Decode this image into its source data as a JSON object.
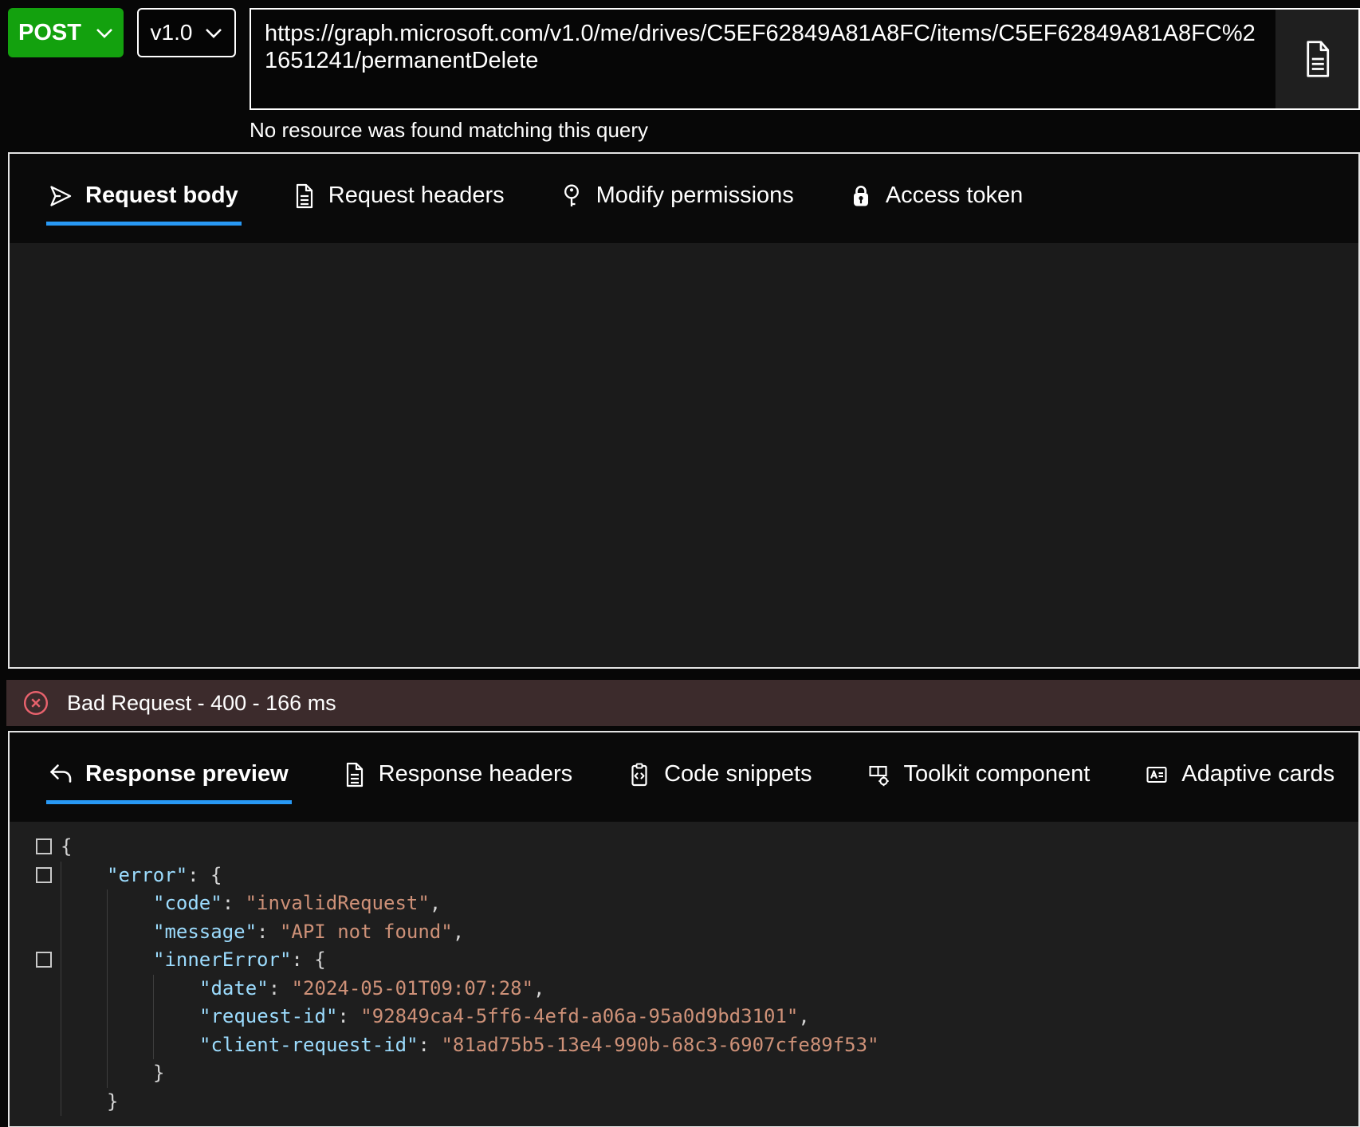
{
  "colors": {
    "accent": "#2899f5",
    "method_green": "#13a10e",
    "error_red": "#e8626d",
    "error_bar_bg": "#3c2b2c",
    "code_key": "#9cdcfe",
    "code_string": "#ce9178",
    "code_punct": "#d4d4d4"
  },
  "request_bar": {
    "method": "POST",
    "version": "v1.0",
    "url": "https://graph.microsoft.com/v1.0/me/drives/C5EF62849A81A8FC/items/C5EF62849A81A8FC%21651241/permanentDelete",
    "hint": "No resource was found matching this query"
  },
  "request_tabs": [
    {
      "label": "Request body",
      "icon": "send-icon",
      "active": true
    },
    {
      "label": "Request headers",
      "icon": "document-icon",
      "active": false
    },
    {
      "label": "Modify permissions",
      "icon": "key-icon",
      "active": false
    },
    {
      "label": "Access token",
      "icon": "lock-icon",
      "active": false
    }
  ],
  "status": {
    "text": "Bad Request - 400 - 166 ms",
    "icon": "error-circle-icon"
  },
  "response_tabs": [
    {
      "label": "Response preview",
      "icon": "reply-arrow-icon",
      "active": true
    },
    {
      "label": "Response headers",
      "icon": "document-icon",
      "active": false
    },
    {
      "label": "Code snippets",
      "icon": "code-snippet-icon",
      "active": false
    },
    {
      "label": "Toolkit component",
      "icon": "toolkit-icon",
      "active": false
    },
    {
      "label": "Adaptive cards",
      "icon": "adaptive-card-icon",
      "active": false
    }
  ],
  "response_json": {
    "lines": [
      {
        "fold": true,
        "indent": 0,
        "tokens": [
          [
            "p",
            "{"
          ]
        ]
      },
      {
        "fold": true,
        "indent": 1,
        "tokens": [
          [
            "k",
            "\"error\""
          ],
          [
            "p",
            ": {"
          ]
        ]
      },
      {
        "fold": false,
        "indent": 2,
        "tokens": [
          [
            "k",
            "\"code\""
          ],
          [
            "p",
            ": "
          ],
          [
            "s",
            "\"invalidRequest\""
          ],
          [
            "p",
            ","
          ]
        ]
      },
      {
        "fold": false,
        "indent": 2,
        "tokens": [
          [
            "k",
            "\"message\""
          ],
          [
            "p",
            ": "
          ],
          [
            "s",
            "\"API not found\""
          ],
          [
            "p",
            ","
          ]
        ]
      },
      {
        "fold": true,
        "indent": 2,
        "tokens": [
          [
            "k",
            "\"innerError\""
          ],
          [
            "p",
            ": {"
          ]
        ]
      },
      {
        "fold": false,
        "indent": 3,
        "tokens": [
          [
            "k",
            "\"date\""
          ],
          [
            "p",
            ": "
          ],
          [
            "s",
            "\"2024-05-01T09:07:28\""
          ],
          [
            "p",
            ","
          ]
        ]
      },
      {
        "fold": false,
        "indent": 3,
        "tokens": [
          [
            "k",
            "\"request-id\""
          ],
          [
            "p",
            ": "
          ],
          [
            "s",
            "\"92849ca4-5ff6-4efd-a06a-95a0d9bd3101\""
          ],
          [
            "p",
            ","
          ]
        ]
      },
      {
        "fold": false,
        "indent": 3,
        "tokens": [
          [
            "k",
            "\"client-request-id\""
          ],
          [
            "p",
            ": "
          ],
          [
            "s",
            "\"81ad75b5-13e4-990b-68c3-6907cfe89f53\""
          ]
        ]
      },
      {
        "fold": false,
        "indent": 2,
        "tokens": [
          [
            "p",
            "}"
          ]
        ]
      },
      {
        "fold": false,
        "indent": 1,
        "tokens": [
          [
            "p",
            "}"
          ]
        ]
      }
    ]
  }
}
